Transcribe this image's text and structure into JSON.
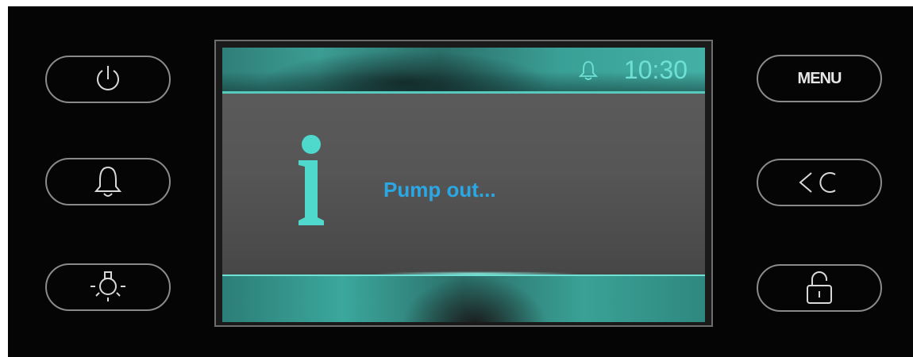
{
  "left_buttons": [
    {
      "name": "power-button",
      "icon": "power-icon"
    },
    {
      "name": "alarm-button",
      "icon": "bell-icon"
    },
    {
      "name": "light-button",
      "icon": "light-bulb-icon"
    }
  ],
  "right_buttons": {
    "menu_label": "MENU",
    "back_icon": "back-clear-icon",
    "lock_icon": "unlock-icon"
  },
  "screen": {
    "status_bar": {
      "alarm_icon": "bell-icon",
      "time": "10:30"
    },
    "info_icon": "info-icon",
    "message": "Pump out..."
  },
  "colors": {
    "accent_teal": "#43b0a6",
    "clock_text": "#6fe0d4",
    "message_text": "#2aa8e6",
    "info_icon": "#4fd8cc"
  }
}
